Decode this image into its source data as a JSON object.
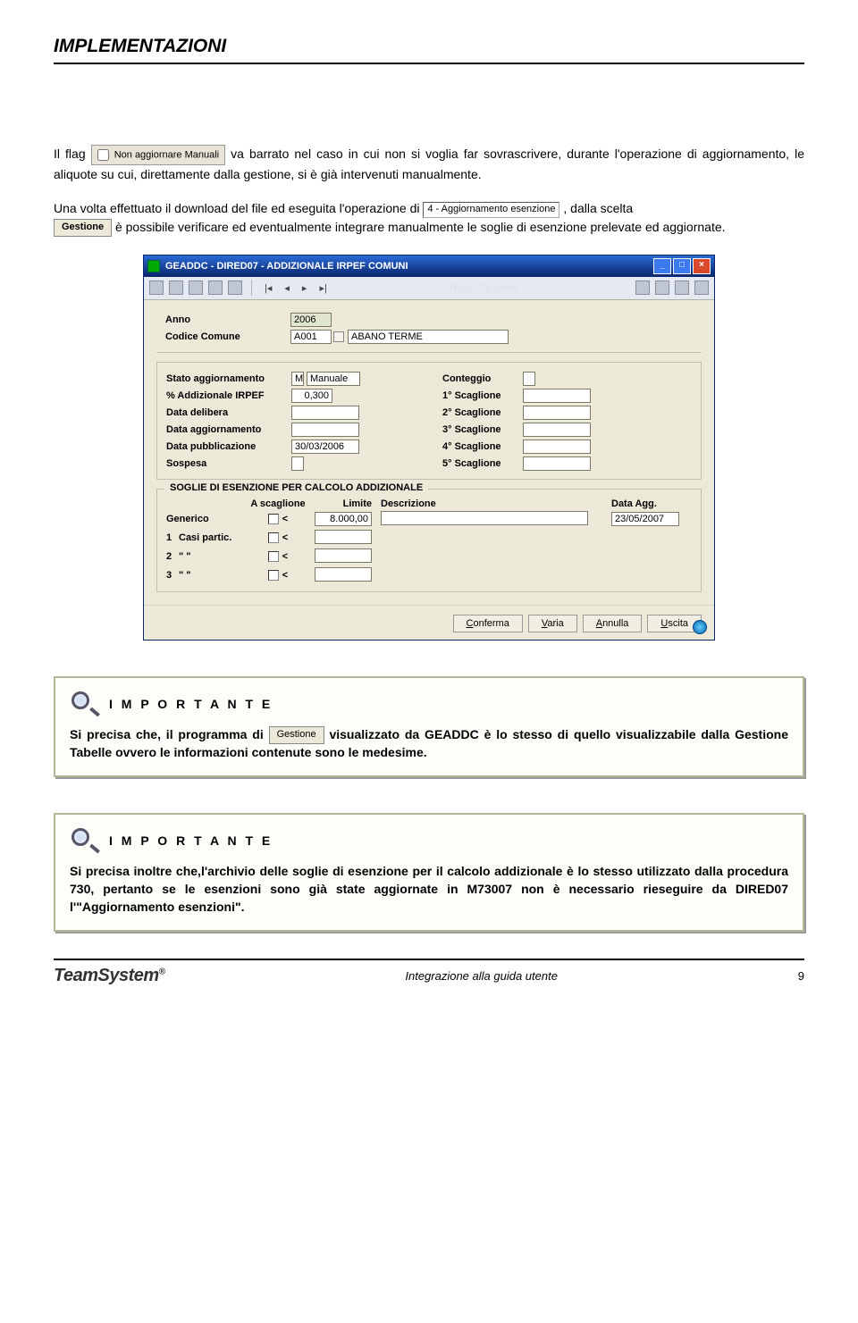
{
  "doc": {
    "header": "IMPLEMENTAZIONI",
    "footer_center": "Integrazione alla guida utente",
    "footer_page": "9",
    "logo": "TeamSystem",
    "logo_suffix": "®"
  },
  "para1_pre": "Il flag ",
  "flag_label": "Non aggiornare Manuali",
  "para1_post": " va barrato nel caso in cui non si voglia far sovrascrivere, durante l'operazione di aggiornamento, le aliquote su cui, direttamente dalla gestione, si è già intervenuti manualmente.",
  "para2_a": "Una volta effettuato il download del file ed eseguita l'operazione di ",
  "op_label": "4 - Aggiornamento esenzione",
  "para2_b": ", dalla scelta ",
  "btn_gestione": "Gestione",
  "para2_c": " è possibile verificare ed eventualmente integrare manualmente le soglie di esenzione prelevate ed aggiornate.",
  "win": {
    "title": "GEADDC  - DIRED07 -  ADDIZIONALE IRPEF COMUNI",
    "brand": "TeamSystem",
    "labels": {
      "anno": "Anno",
      "codice": "Codice Comune",
      "stato": "Stato aggiornamento",
      "perc": "% Addizionale IRPEF",
      "delibera": "Data delibera",
      "aggio": "Data aggiornamento",
      "pubbl": "Data pubblicazione",
      "sospesa": "Sospesa",
      "conteggio": "Conteggio",
      "s1": "1° Scaglione",
      "s2": "2° Scaglione",
      "s3": "3° Scaglione",
      "s4": "4° Scaglione",
      "s5": "5° Scaglione"
    },
    "values": {
      "anno": "2006",
      "codice": "A001",
      "comune": "ABANO TERME",
      "stato_code": "M",
      "stato_desc": "Manuale",
      "perc": "0,300",
      "delibera": "",
      "aggio": "",
      "pubbl": "30/03/2006",
      "sospesa": "",
      "conteggio": "",
      "s1": "",
      "s2": "",
      "s3": "",
      "s4": "",
      "s5": ""
    },
    "soglie": {
      "title": "SOGLIE DI ESENZIONE PER CALCOLO ADDIZIONALE",
      "head_ascagl": "A scaglione",
      "head_limite": "Limite",
      "head_descr": "Descrizione",
      "head_data": "Data Agg.",
      "rows": [
        {
          "idx": "",
          "label": "Generico",
          "lt": "<",
          "limite": "8.000,00",
          "descr": "",
          "data": "23/05/2007"
        },
        {
          "idx": "1",
          "label": "Casi partic.",
          "lt": "<",
          "limite": "",
          "descr": "",
          "data": ""
        },
        {
          "idx": "2",
          "label": "\"     \"",
          "lt": "<",
          "limite": "",
          "descr": "",
          "data": ""
        },
        {
          "idx": "3",
          "label": "\"     \"",
          "lt": "<",
          "limite": "",
          "descr": "",
          "data": ""
        }
      ]
    },
    "buttons": {
      "conferma": "Conferma",
      "varia": "Varia",
      "annulla": "Annulla",
      "uscita": "Uscita"
    }
  },
  "importante": {
    "title": "I M P O R T A N T E",
    "box1_a": "Si precisa che, il programma di ",
    "box1_b": " visualizzato da GEADDC è lo stesso di quello visualizzabile dalla Gestione Tabelle ovvero le informazioni contenute sono le medesime.",
    "box2": "Si precisa inoltre che,l'archivio delle soglie di esenzione per il calcolo addizionale è lo stesso utilizzato dalla procedura 730, pertanto se le esenzioni sono già state aggiornate in M73007 non è necessario rieseguire da DIRED07 l'\"Aggiornamento esenzioni\"."
  }
}
